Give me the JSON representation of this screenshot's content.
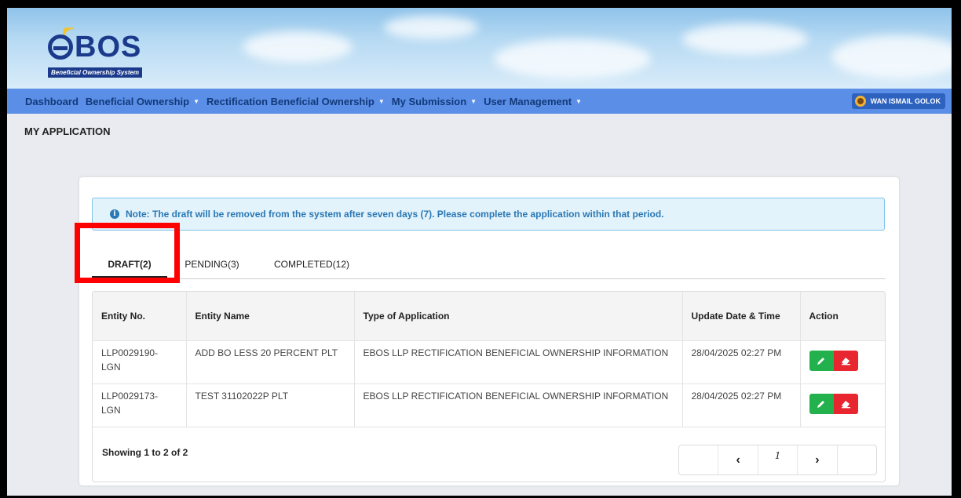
{
  "header": {
    "logo_text": "BOS",
    "logo_subtitle": "Beneficial Ownership System"
  },
  "nav": {
    "items": [
      {
        "label": "Dashboard",
        "has_caret": false
      },
      {
        "label": "Beneficial Ownership",
        "has_caret": true
      },
      {
        "label": "Rectification Beneficial Ownership",
        "has_caret": true
      },
      {
        "label": "My Submission",
        "has_caret": true
      },
      {
        "label": "User Management",
        "has_caret": true
      }
    ],
    "user_name": "WAN ISMAIL GOLOK"
  },
  "page": {
    "title": "MY APPLICATION",
    "note": "Note: The draft will be removed from the system after seven days (7). Please complete the application within that period."
  },
  "tabs": [
    {
      "label": "DRAFT(2)",
      "active": true
    },
    {
      "label": "PENDING(3)",
      "active": false
    },
    {
      "label": "COMPLETED(12)",
      "active": false
    }
  ],
  "table": {
    "headers": [
      "Entity No.",
      "Entity Name",
      "Type of Application",
      "Update Date & Time",
      "Action"
    ],
    "rows": [
      {
        "entity_no": "LLP0029190-LGN",
        "entity_name": "ADD BO LESS 20 PERCENT PLT",
        "type": "EBOS LLP RECTIFICATION BENEFICIAL OWNERSHIP INFORMATION",
        "updated": "28/04/2025 02:27 PM"
      },
      {
        "entity_no": "LLP0029173-LGN",
        "entity_name": "TEST 31102022P PLT",
        "type": "EBOS LLP RECTIFICATION BENEFICIAL OWNERSHIP INFORMATION",
        "updated": "28/04/2025 02:27 PM"
      }
    ],
    "showing": "Showing 1 to 2 of 2"
  },
  "pagination": {
    "prev": "‹",
    "current": "1",
    "next": "›"
  },
  "colors": {
    "navbar": "#5b8ee6",
    "edit_button": "#22b14c",
    "erase_button": "#e8262f",
    "note_text": "#2a78b5",
    "highlight": "#ff0000"
  },
  "icons": [
    "info-icon",
    "pencil-icon",
    "eraser-icon",
    "chevron-left-icon",
    "chevron-right-icon",
    "user-avatar-icon"
  ]
}
